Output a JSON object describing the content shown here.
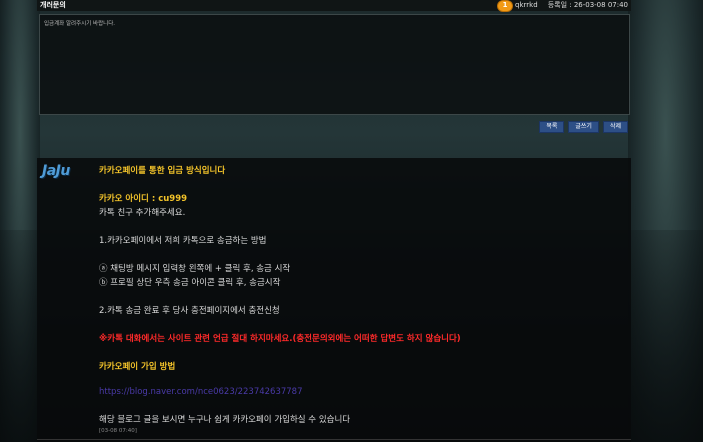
{
  "header": {
    "title": "개러문의",
    "badge": "1",
    "author": "qkrrkd",
    "date": "등록일 : 26-03-08 07:40"
  },
  "question": {
    "text": "입금계좌 알려주시기 바랍니다."
  },
  "buttons": {
    "list": "목록",
    "write": "글쓰기",
    "delete": "삭제"
  },
  "answer": {
    "logo": "JaJu",
    "lines": {
      "l1": "카카오페이를 통한 입금 방식입니다",
      "l2": "카카오 아이디 : cu999",
      "l3": "카톡 친구 추가해주세요.",
      "l4": "1.카카오페이에서 저희 카톡으로 송금하는 방법",
      "l5": "ⓐ 채팅방 메시지 입력창 왼쪽에 + 클릭 후, 송금 시작",
      "l6": "ⓑ 프로필 상단 우측 송금 아이콘 클릭 후, 송금시작",
      "l7": "2.카톡 송금 완료 후 당사 충전페이지에서 충전신청",
      "l8": "※카톡 대화에서는 사이트 관련 언급 절대 하지마세요.(충전문의외에는 어떠한 답변도 하지 않습니다)",
      "l9": "카카오페이 가입 방법",
      "l10": "https://blog.naver.com/nce0623/223742637787",
      "l11": "해당 블로그 글을 보시면 누구나 쉽게 카카오페이 가입하실 수 있습니다"
    },
    "stamp": "[03-08 07:40]"
  }
}
